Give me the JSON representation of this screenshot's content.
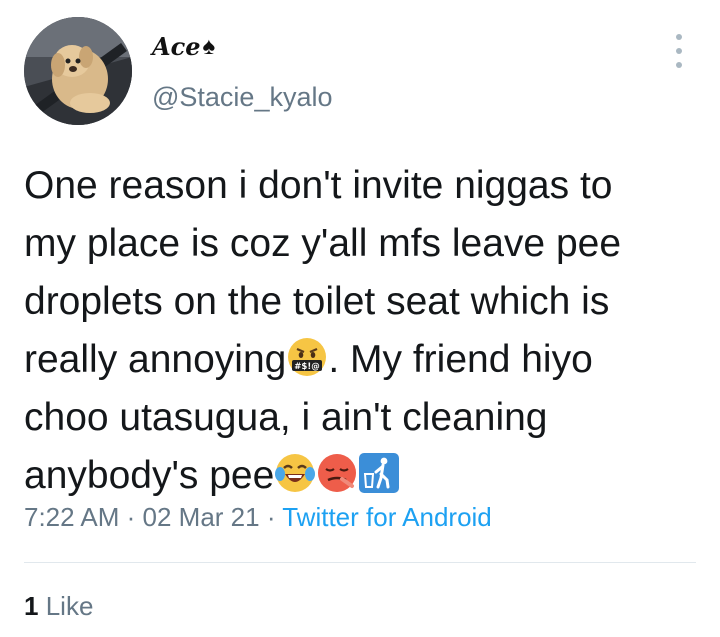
{
  "author": {
    "display_name": "Ace",
    "display_name_icon": "spade-icon",
    "handle": "@Stacie_kyalo",
    "avatar": "puppy-in-car-seat-photo"
  },
  "more_icon": "vertical-ellipsis-icon",
  "tweet": {
    "lines": [
      "One reason i don't invite niggas to",
      "my place is coz y'all mfs leave pee",
      "droplets on the toilet seat which is",
      "really annoying",
      ". My friend hiyo",
      "choo utasugua, i ain't cleaning",
      "anybody's pee"
    ],
    "emojis": [
      "face-with-symbols-on-mouth-emoji",
      "face-with-tears-of-joy-emoji",
      "hot-face-emoji",
      "put-litter-in-its-place-emoji"
    ],
    "emoji_symbol_text": "#$!@"
  },
  "meta": {
    "time": "7:22 AM",
    "sep1": " · ",
    "date": "02 Mar 21",
    "sep2": " · ",
    "source": "Twitter for Android"
  },
  "likes": {
    "count": "1",
    "label": "Like"
  },
  "colors": {
    "secondary_text": "#657786",
    "link": "#1da1f2",
    "divider": "#e1e8ed"
  }
}
